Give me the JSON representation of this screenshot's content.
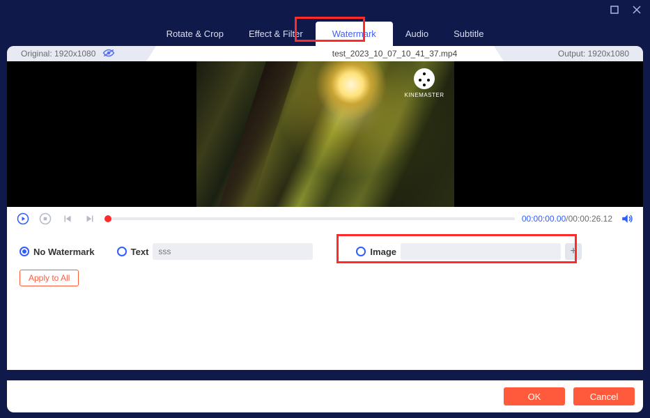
{
  "tabs": {
    "rotate": "Rotate & Crop",
    "effect": "Effect & Filter",
    "watermark": "Watermark",
    "audio": "Audio",
    "subtitle": "Subtitle"
  },
  "info": {
    "original_label": "Original: 1920x1080",
    "filename": "test_2023_10_07_10_41_37.mp4",
    "output_label": "Output: 1920x1080"
  },
  "kinemaster_label": "KINEMASTER",
  "time": {
    "current": "00:00:00.00",
    "total": "/00:00:26.12"
  },
  "watermark": {
    "no_label": "No Watermark",
    "text_label": "Text",
    "text_placeholder": "sss",
    "image_label": "Image",
    "add_label": "+",
    "apply_label": "Apply to All"
  },
  "footer": {
    "ok": "OK",
    "cancel": "Cancel"
  }
}
